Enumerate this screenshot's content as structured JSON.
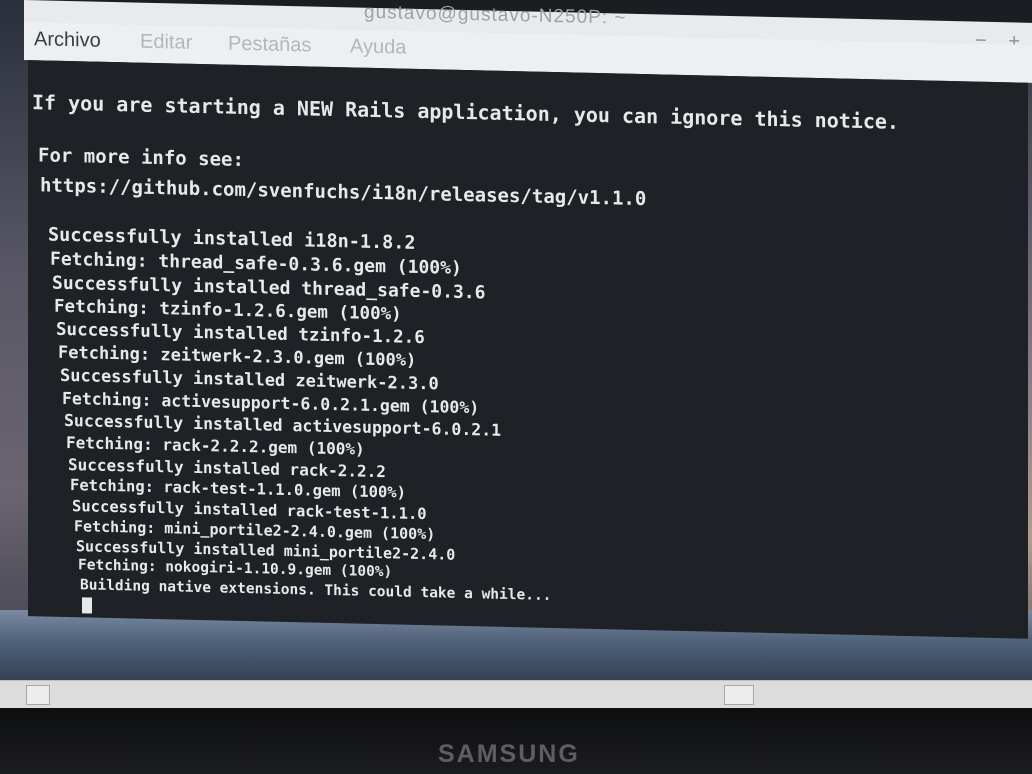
{
  "window": {
    "title": "gustavo@gustavo-N250P: ~",
    "controls": [
      "−",
      "+"
    ]
  },
  "menubar": {
    "items": [
      "Archivo",
      "Editar",
      "Pestañas",
      "Ayuda"
    ]
  },
  "terminal": {
    "lines": [
      "If you are starting a NEW Rails application, you can ignore this notice.",
      "",
      "For more info see:",
      "https://github.com/svenfuchs/i18n/releases/tag/v1.1.0",
      "",
      "Successfully installed i18n-1.8.2",
      "Fetching: thread_safe-0.3.6.gem (100%)",
      "Successfully installed thread_safe-0.3.6",
      "Fetching: tzinfo-1.2.6.gem (100%)",
      "Successfully installed tzinfo-1.2.6",
      "Fetching: zeitwerk-2.3.0.gem (100%)",
      "Successfully installed zeitwerk-2.3.0",
      "Fetching: activesupport-6.0.2.1.gem (100%)",
      "Successfully installed activesupport-6.0.2.1",
      "Fetching: rack-2.2.2.gem (100%)",
      "Successfully installed rack-2.2.2",
      "Fetching: rack-test-1.1.0.gem (100%)",
      "Successfully installed rack-test-1.1.0",
      "Fetching: mini_portile2-2.4.0.gem (100%)",
      "Successfully installed mini_portile2-2.4.0",
      "Fetching: nokogiri-1.10.9.gem (100%)",
      "Building native extensions. This could take a while..."
    ]
  },
  "bezel": {
    "brand": "SAMSUNG"
  },
  "colors": {
    "terminal_bg": "#1e2226",
    "terminal_fg": "#e8e8e8",
    "menubar_bg": "#eeeff0"
  }
}
